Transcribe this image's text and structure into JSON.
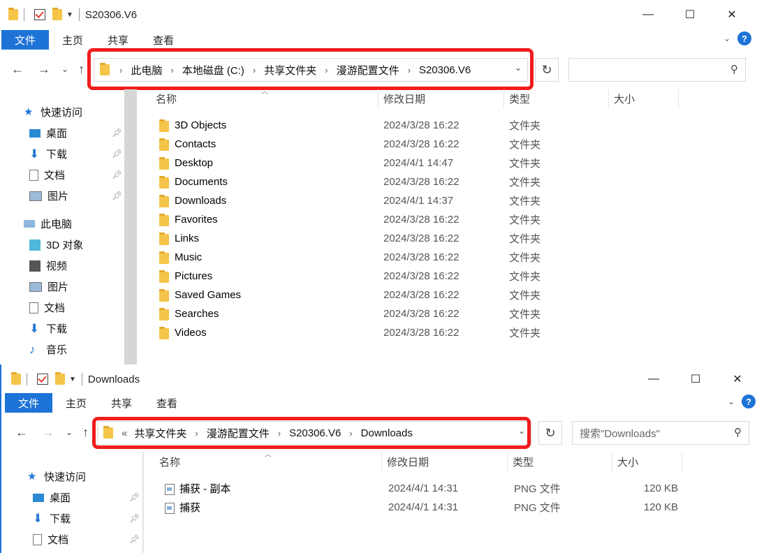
{
  "window1": {
    "title": "S20306.V6",
    "ribbon_tabs": [
      "文件",
      "主页",
      "共享",
      "查看"
    ],
    "breadcrumb": [
      "此电脑",
      "本地磁盘 (C:)",
      "共享文件夹",
      "漫游配置文件",
      "S20306.V6"
    ],
    "search_placeholder": "",
    "sidebar": {
      "quick_access": "快速访问",
      "quick_items": [
        "桌面",
        "下载",
        "文档",
        "图片"
      ],
      "this_pc": "此电脑",
      "pc_items": [
        "3D 对象",
        "视频",
        "图片",
        "文档",
        "下载",
        "音乐"
      ]
    },
    "columns": [
      "名称",
      "修改日期",
      "类型",
      "大小"
    ],
    "files": [
      {
        "name": "3D Objects",
        "date": "2024/3/28 16:22",
        "type": "文件夹",
        "size": ""
      },
      {
        "name": "Contacts",
        "date": "2024/3/28 16:22",
        "type": "文件夹",
        "size": ""
      },
      {
        "name": "Desktop",
        "date": "2024/4/1 14:47",
        "type": "文件夹",
        "size": ""
      },
      {
        "name": "Documents",
        "date": "2024/3/28 16:22",
        "type": "文件夹",
        "size": ""
      },
      {
        "name": "Downloads",
        "date": "2024/4/1 14:37",
        "type": "文件夹",
        "size": ""
      },
      {
        "name": "Favorites",
        "date": "2024/3/28 16:22",
        "type": "文件夹",
        "size": ""
      },
      {
        "name": "Links",
        "date": "2024/3/28 16:22",
        "type": "文件夹",
        "size": ""
      },
      {
        "name": "Music",
        "date": "2024/3/28 16:22",
        "type": "文件夹",
        "size": ""
      },
      {
        "name": "Pictures",
        "date": "2024/3/28 16:22",
        "type": "文件夹",
        "size": ""
      },
      {
        "name": "Saved Games",
        "date": "2024/3/28 16:22",
        "type": "文件夹",
        "size": ""
      },
      {
        "name": "Searches",
        "date": "2024/3/28 16:22",
        "type": "文件夹",
        "size": ""
      },
      {
        "name": "Videos",
        "date": "2024/3/28 16:22",
        "type": "文件夹",
        "size": ""
      }
    ]
  },
  "window2": {
    "title": "Downloads",
    "ribbon_tabs": [
      "文件",
      "主页",
      "共享",
      "查看"
    ],
    "breadcrumb_overflow": "«",
    "breadcrumb": [
      "共享文件夹",
      "漫游配置文件",
      "S20306.V6",
      "Downloads"
    ],
    "search_placeholder": "搜索\"Downloads\"",
    "sidebar": {
      "quick_access": "快速访问",
      "quick_items": [
        "桌面",
        "下载",
        "文档"
      ]
    },
    "columns": [
      "名称",
      "修改日期",
      "类型",
      "大小"
    ],
    "files": [
      {
        "name": "捕获 - 副本",
        "date": "2024/4/1 14:31",
        "type": "PNG 文件",
        "size": "120 KB"
      },
      {
        "name": "捕获",
        "date": "2024/4/1 14:31",
        "type": "PNG 文件",
        "size": "120 KB"
      }
    ]
  },
  "colors": {
    "accent": "#1e73d6",
    "highlight": "#f11c1c",
    "folder": "#f5c54a"
  },
  "window_controls": {
    "minimize": "—",
    "maximize": "☐",
    "close": "✕"
  }
}
